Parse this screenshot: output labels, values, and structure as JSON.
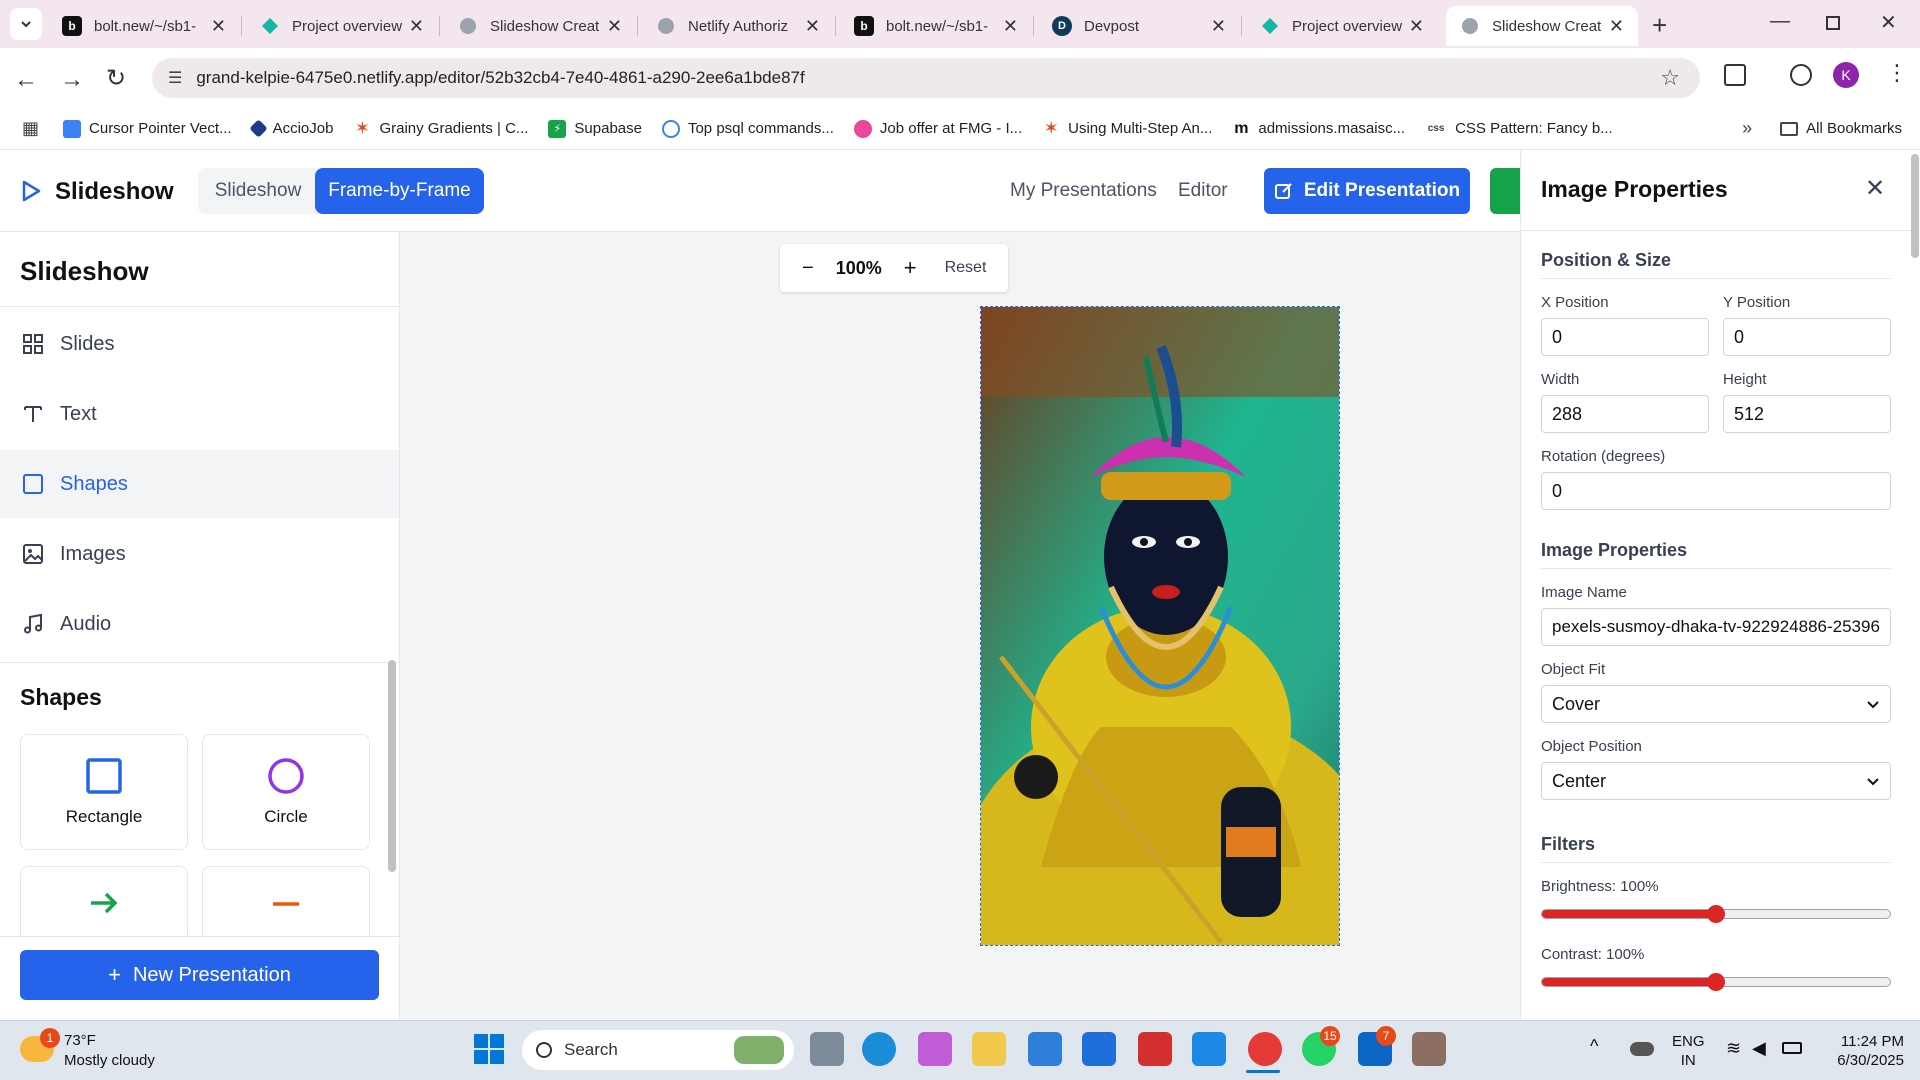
{
  "browser": {
    "tabs": [
      {
        "title": "bolt.new/~/sb1-"
      },
      {
        "title": "Project overview"
      },
      {
        "title": "Slideshow Creat"
      },
      {
        "title": "Netlify Authoriz"
      },
      {
        "title": "bolt.new/~/sb1-"
      },
      {
        "title": "Devpost"
      },
      {
        "title": "Project overview"
      },
      {
        "title": "Slideshow Creat"
      }
    ],
    "url": "grand-kelpie-6475e0.netlify.app/editor/52b32cb4-7e40-4861-a290-2ee6a1bde87f",
    "profile_initial": "K",
    "bookmarks": [
      {
        "label": "Cursor Pointer Vect..."
      },
      {
        "label": "AccioJob"
      },
      {
        "label": "Grainy Gradients | C..."
      },
      {
        "label": "Supabase"
      },
      {
        "label": "Top psql commands..."
      },
      {
        "label": "Job offer at FMG - I..."
      },
      {
        "label": "Using Multi-Step An..."
      },
      {
        "label": "admissions.masaisc..."
      },
      {
        "label": "CSS Pattern: Fancy b..."
      }
    ],
    "all_bookmarks": "All Bookmarks"
  },
  "app": {
    "brand": "Slideshow",
    "mode_tabs": {
      "slideshow": "Slideshow",
      "frame": "Frame-by-Frame"
    },
    "nav_links": {
      "my_presentations": "My Presentations",
      "editor": "Editor"
    },
    "edit_button": "Edit Presentation",
    "accent_color": "#2563eb"
  },
  "sidebar": {
    "title": "Slideshow",
    "items": [
      {
        "label": "Slides",
        "icon": "grid-icon"
      },
      {
        "label": "Text",
        "icon": "text-icon"
      },
      {
        "label": "Shapes",
        "icon": "square-icon"
      },
      {
        "label": "Images",
        "icon": "image-icon"
      },
      {
        "label": "Audio",
        "icon": "music-icon"
      }
    ],
    "active_item": "Shapes",
    "shapes_heading": "Shapes",
    "shapes": [
      {
        "label": "Rectangle"
      },
      {
        "label": "Circle"
      },
      {
        "label": ""
      },
      {
        "label": ""
      }
    ],
    "new_presentation": "New Presentation"
  },
  "zoom": {
    "value": "100%",
    "reset": "Reset"
  },
  "panel": {
    "title": "Image Properties",
    "position_size": {
      "heading": "Position & Size",
      "x_label": "X Position",
      "x_value": "0",
      "y_label": "Y Position",
      "y_value": "0",
      "w_label": "Width",
      "w_value": "288",
      "h_label": "Height",
      "h_value": "512",
      "rot_label": "Rotation (degrees)",
      "rot_value": "0"
    },
    "image_props": {
      "heading": "Image Properties",
      "name_label": "Image Name",
      "name_value": "pexels-susmoy-dhaka-tv-922924886-25396",
      "fit_label": "Object Fit",
      "fit_value": "Cover",
      "pos_label": "Object Position",
      "pos_value": "Center"
    },
    "filters": {
      "heading": "Filters",
      "brightness_label": "Brightness: 100%",
      "brightness_fraction": 0.5,
      "contrast_label": "Contrast: 100%",
      "contrast_fraction": 0.5
    }
  },
  "taskbar": {
    "weather_temp": "73°F",
    "weather_desc": "Mostly cloudy",
    "weather_badge": "1",
    "search": "Search",
    "whatsapp_badge": "15",
    "linkedin_badge": "7",
    "lang": "ENG",
    "region": "IN",
    "time": "11:24 PM",
    "date": "6/30/2025"
  }
}
